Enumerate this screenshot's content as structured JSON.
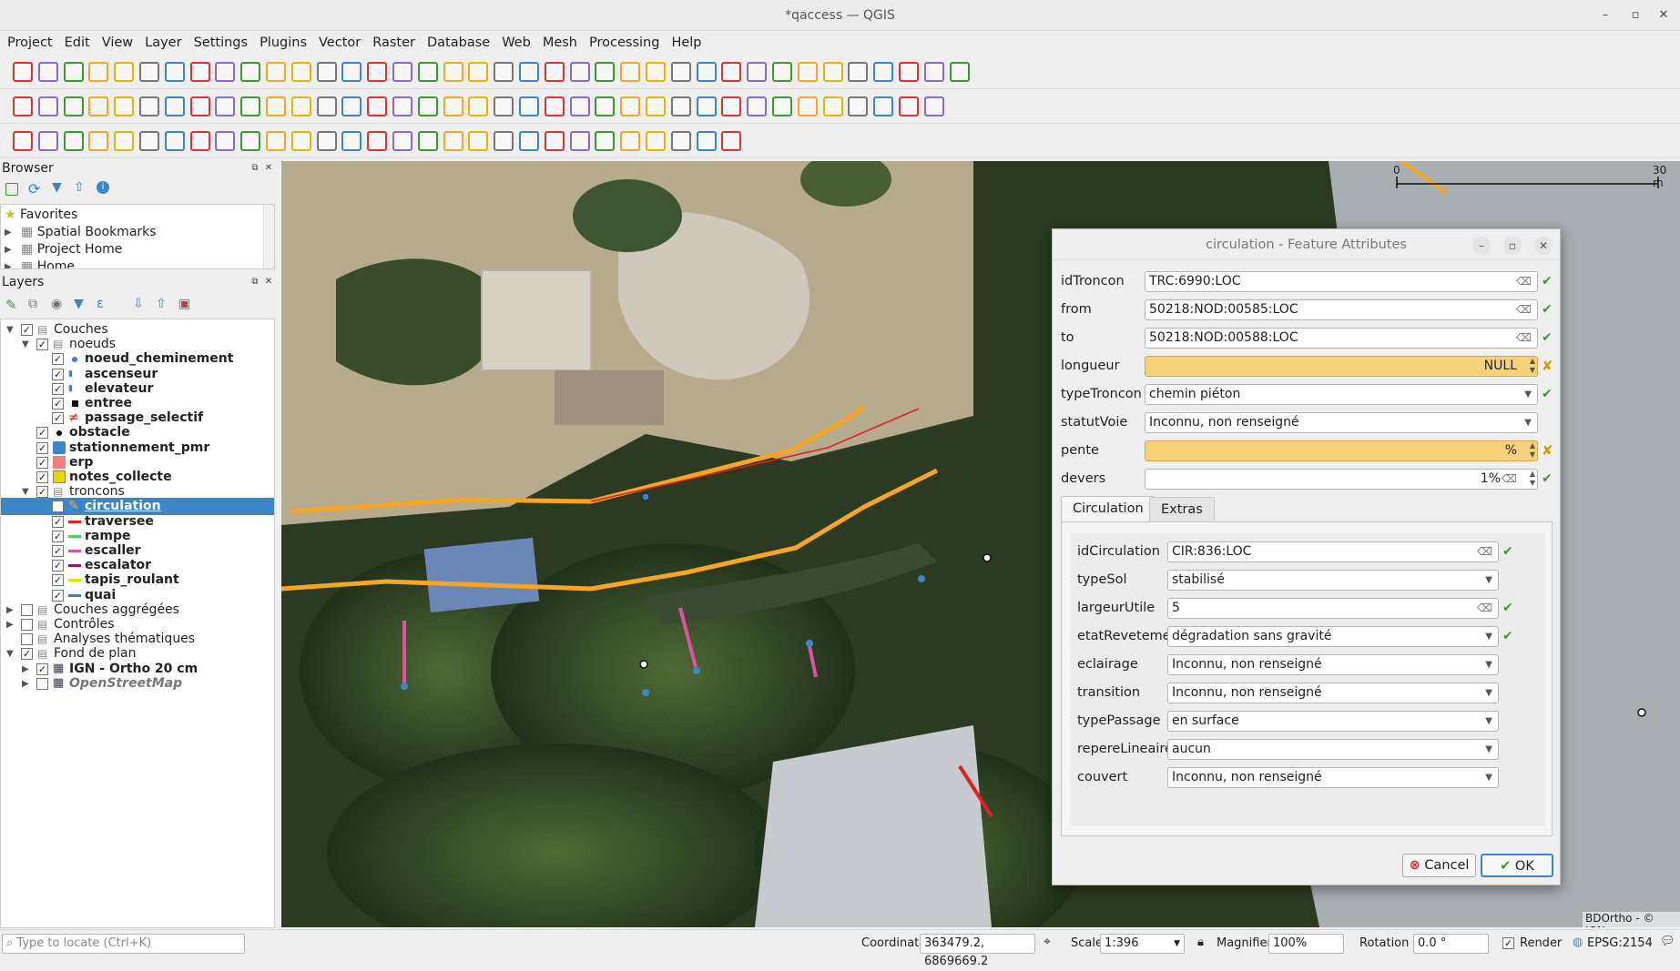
{
  "window": {
    "title": "*qaccess — QGIS"
  },
  "menu": [
    "Project",
    "Edit",
    "View",
    "Layer",
    "Settings",
    "Plugins",
    "Vector",
    "Raster",
    "Database",
    "Web",
    "Mesh",
    "Processing",
    "Help"
  ],
  "browser": {
    "title": "Browser",
    "items": [
      "Favorites",
      "Spatial Bookmarks",
      "Project Home",
      "Home"
    ]
  },
  "layers": {
    "title": "Layers",
    "items": [
      {
        "label": "Couches",
        "bold": false
      },
      {
        "label": "noeuds",
        "bold": false
      },
      {
        "label": "noeud_cheminement",
        "bold": true
      },
      {
        "label": "ascenseur",
        "bold": true
      },
      {
        "label": "elevateur",
        "bold": true
      },
      {
        "label": "entree",
        "bold": true
      },
      {
        "label": "passage_selectif",
        "bold": true
      },
      {
        "label": "obstacle",
        "bold": true
      },
      {
        "label": "stationnement_pmr",
        "bold": true
      },
      {
        "label": "erp",
        "bold": true
      },
      {
        "label": "notes_collecte",
        "bold": true
      },
      {
        "label": "troncons",
        "bold": false
      },
      {
        "label": "circulation",
        "bold": true
      },
      {
        "label": "traversee",
        "bold": true
      },
      {
        "label": "rampe",
        "bold": true
      },
      {
        "label": "escaller",
        "bold": true
      },
      {
        "label": "escalator",
        "bold": true
      },
      {
        "label": "tapis_roulant",
        "bold": true
      },
      {
        "label": "quai",
        "bold": true
      },
      {
        "label": "Couches aggrégées",
        "bold": false
      },
      {
        "label": "Contrôles",
        "bold": false
      },
      {
        "label": "Analyses thématiques",
        "bold": false
      },
      {
        "label": "Fond de plan",
        "bold": false
      },
      {
        "label": "IGN - Ortho 20 cm",
        "bold": true
      },
      {
        "label": "OpenStreetMap",
        "bold": true
      }
    ]
  },
  "map": {
    "scalebar_start": "0",
    "scalebar_end": "30 m",
    "credit": "BDOrtho - © IGN"
  },
  "dialog": {
    "title": "circulation - Feature Attributes",
    "fields": {
      "idTroncon": {
        "label": "idTroncon",
        "value": "TRC:6990:LOC"
      },
      "from": {
        "label": "from",
        "value": "50218:NOD:00585:LOC"
      },
      "to": {
        "label": "to",
        "value": "50218:NOD:00588:LOC"
      },
      "longueur": {
        "label": "longueur",
        "value": "NULL"
      },
      "typeTroncon": {
        "label": "typeTroncon",
        "value": "chemin piéton"
      },
      "statutVoie": {
        "label": "statutVoie",
        "value": "Inconnu, non renseigné"
      },
      "pente": {
        "label": "pente",
        "value": "%"
      },
      "devers": {
        "label": "devers",
        "value": "1%"
      }
    },
    "tabs": [
      "Circulation",
      "Extras"
    ],
    "circulation": {
      "idCirculation": {
        "label": "idCirculation",
        "value": "CIR:836:LOC"
      },
      "typeSol": {
        "label": "typeSol",
        "value": "stabilisé"
      },
      "largeurUtile": {
        "label": "largeurUtile",
        "value": "5"
      },
      "etatRevetement": {
        "label": "etatRevetement",
        "value": "dégradation sans gravité"
      },
      "eclairage": {
        "label": "eclairage",
        "value": "Inconnu, non renseigné"
      },
      "transition": {
        "label": "transition",
        "value": "Inconnu, non renseigné"
      },
      "typePassage": {
        "label": "typePassage",
        "value": "en surface"
      },
      "repereLineaire": {
        "label": "repereLineaire",
        "value": "aucun"
      },
      "couvert": {
        "label": "couvert",
        "value": "Inconnu, non renseigné"
      }
    },
    "cancel": "Cancel",
    "ok": "OK"
  },
  "status": {
    "locate_placeholder": "Type to locate (Ctrl+K)",
    "coordinate_label": "Coordinate",
    "coordinate_value": "363479.2, 6869669.2",
    "scale_label": "Scale",
    "scale_value": "1:396",
    "magnifier_label": "Magnifier",
    "magnifier_value": "100%",
    "rotation_label": "Rotation",
    "rotation_value": "0.0 °",
    "render_label": "Render",
    "crs": "EPSG:2154"
  },
  "colors": {
    "selection": "#3c85c9",
    "orange_line": "#f6a623",
    "pink_line": "#e050a5",
    "red_line": "#e02020",
    "required_yellow": "#f7d27a"
  }
}
